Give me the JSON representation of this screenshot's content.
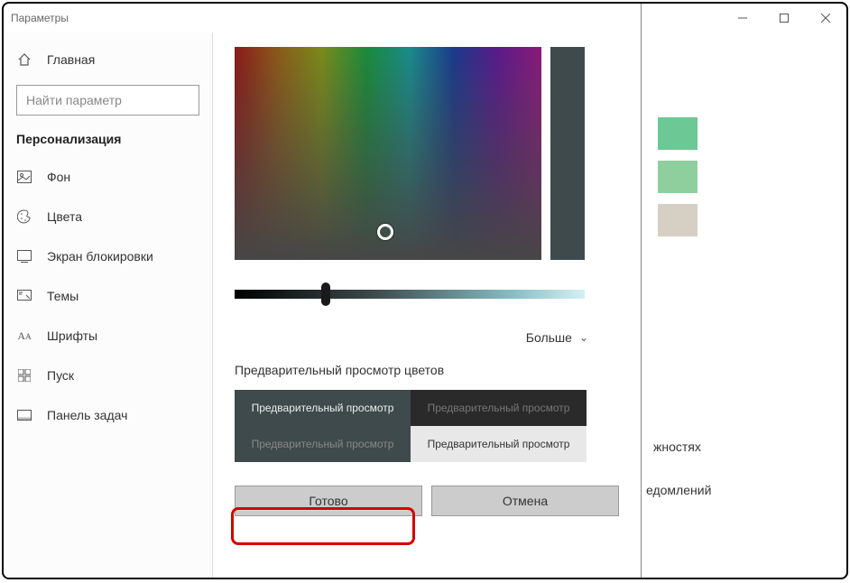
{
  "window": {
    "title": "Параметры"
  },
  "sidebar": {
    "home": "Главная",
    "search_placeholder": "Найти параметр",
    "section": "Персонализация",
    "items": [
      {
        "label": "Фон",
        "icon": "image-icon"
      },
      {
        "label": "Цвета",
        "icon": "palette-icon"
      },
      {
        "label": "Экран блокировки",
        "icon": "lock-screen-icon"
      },
      {
        "label": "Темы",
        "icon": "themes-icon"
      },
      {
        "label": "Шрифты",
        "icon": "fonts-icon"
      },
      {
        "label": "Пуск",
        "icon": "start-icon"
      },
      {
        "label": "Панель задач",
        "icon": "taskbar-icon"
      }
    ]
  },
  "dialog": {
    "more": "Больше",
    "preview_label": "Предварительный просмотр цветов",
    "preview_tile": "Предварительный просмотр",
    "done": "Готово",
    "cancel": "Отмена"
  },
  "background_hints": {
    "swatch_colors": [
      "#6cc894",
      "#8fcf9d",
      "#d6d0c4"
    ],
    "text1": "жностях",
    "text2": "едомлений"
  },
  "colors": {
    "selected": "#3e4a4c"
  }
}
